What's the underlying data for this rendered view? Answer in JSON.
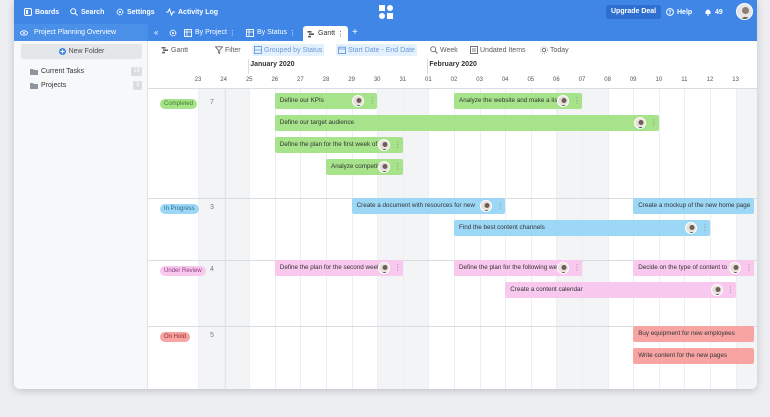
{
  "topbar": {
    "boards": "Boards",
    "search": "Search",
    "settings": "Settings",
    "activity_log": "Activity Log",
    "upgrade": "Upgrade Deal",
    "help": "Help",
    "notifications": "49"
  },
  "subbar": {
    "project_title": "Project Planning Overview",
    "views": [
      "By Project",
      "By Status",
      "Gantt"
    ]
  },
  "sidebar": {
    "new_folder": "New Folder",
    "items": [
      {
        "label": "Current Tasks",
        "count": "19"
      },
      {
        "label": "Projects",
        "count": "3"
      }
    ]
  },
  "toolbar": {
    "gantt": "Gantt",
    "filter": "Filter",
    "grouped": "Grouped by Status",
    "dates": "Start Date - End Date",
    "week": "Week",
    "undated": "Undated Items",
    "today": "Today"
  },
  "timeline": {
    "months": [
      "January 2020",
      "February 2020"
    ],
    "days": [
      "23",
      "24",
      "25",
      "26",
      "27",
      "28",
      "29",
      "30",
      "31",
      "01",
      "02",
      "03",
      "04",
      "05",
      "06",
      "07",
      "08",
      "09",
      "10",
      "11",
      "12",
      "13"
    ]
  },
  "groups": [
    {
      "status": "Completed",
      "count": "7",
      "color": "#a6e38a",
      "text": "#3f7d2b"
    },
    {
      "status": "In Progress",
      "count": "3",
      "color": "#9dd7f6",
      "text": "#2b6a8f"
    },
    {
      "status": "Under Review",
      "count": "4",
      "color": "#f8c8ef",
      "text": "#8f3a7d"
    },
    {
      "status": "On Hold",
      "count": "5",
      "color": "#f7a4a2",
      "text": "#8f2b2b"
    }
  ],
  "tasks": [
    {
      "name": "Define our KPIs",
      "group": 0,
      "lane": 0,
      "start": 3,
      "days": 4,
      "avatar": true
    },
    {
      "name": "Analyze the website and make a list",
      "group": 0,
      "lane": 0,
      "start": 10,
      "days": 5,
      "avatar": true
    },
    {
      "name": "Define our target audience",
      "group": 0,
      "lane": 1,
      "start": 3,
      "days": 15,
      "avatar": true
    },
    {
      "name": "Define the plan for the first week of",
      "group": 0,
      "lane": 2,
      "start": 3,
      "days": 5,
      "avatar": true
    },
    {
      "name": "Analyze competitors",
      "group": 0,
      "lane": 3,
      "start": 5,
      "days": 3,
      "avatar": true
    },
    {
      "name": "Create a document with resources for new",
      "group": 1,
      "lane": 0,
      "start": 6,
      "days": 6,
      "avatar": true
    },
    {
      "name": "Create a mockup of the new home page",
      "group": 1,
      "lane": 0,
      "start": 17,
      "days": 5,
      "avatar": false
    },
    {
      "name": "Find the best content channels",
      "group": 1,
      "lane": 1,
      "start": 10,
      "days": 10,
      "avatar": true
    },
    {
      "name": "Define the plan for the second week",
      "group": 2,
      "lane": 0,
      "start": 3,
      "days": 5,
      "avatar": true
    },
    {
      "name": "Define the plan for the following week",
      "group": 2,
      "lane": 0,
      "start": 10,
      "days": 5,
      "avatar": true
    },
    {
      "name": "Decide on the type of content to use",
      "group": 2,
      "lane": 0,
      "start": 17,
      "days": 5,
      "avatar": true
    },
    {
      "name": "Create a content calendar",
      "group": 2,
      "lane": 1,
      "start": 12,
      "days": 9,
      "avatar": true
    },
    {
      "name": "Buy equipment for new employees",
      "group": 3,
      "lane": 0,
      "start": 17,
      "days": 5,
      "avatar": false
    },
    {
      "name": "Write content for the new pages",
      "group": 3,
      "lane": 1,
      "start": 17,
      "days": 5,
      "avatar": false
    }
  ]
}
